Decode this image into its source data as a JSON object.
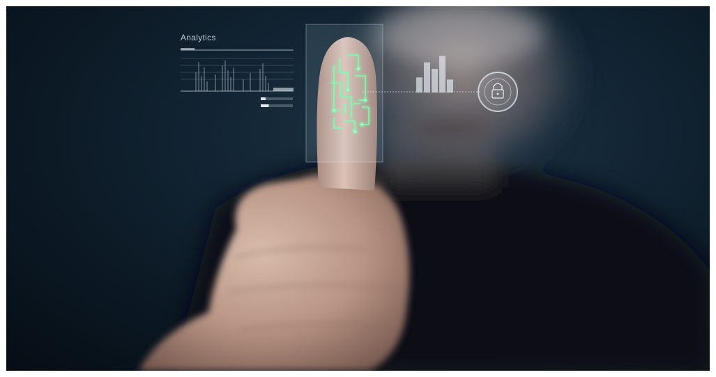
{
  "overlay": {
    "analytics_title": "Analytics",
    "chart_bars": [
      0.35,
      0.7,
      0.55,
      0.85,
      0.3
    ],
    "progress_bars": [
      0.15,
      0.25
    ],
    "lock_icon": "padlock-icon"
  },
  "colors": {
    "background_dark": "#0a1620",
    "hud_light": "#dfe7ee",
    "fingerprint_green": "#7cffb0",
    "shirt": "#0c1116",
    "skin": "#c9a996"
  }
}
